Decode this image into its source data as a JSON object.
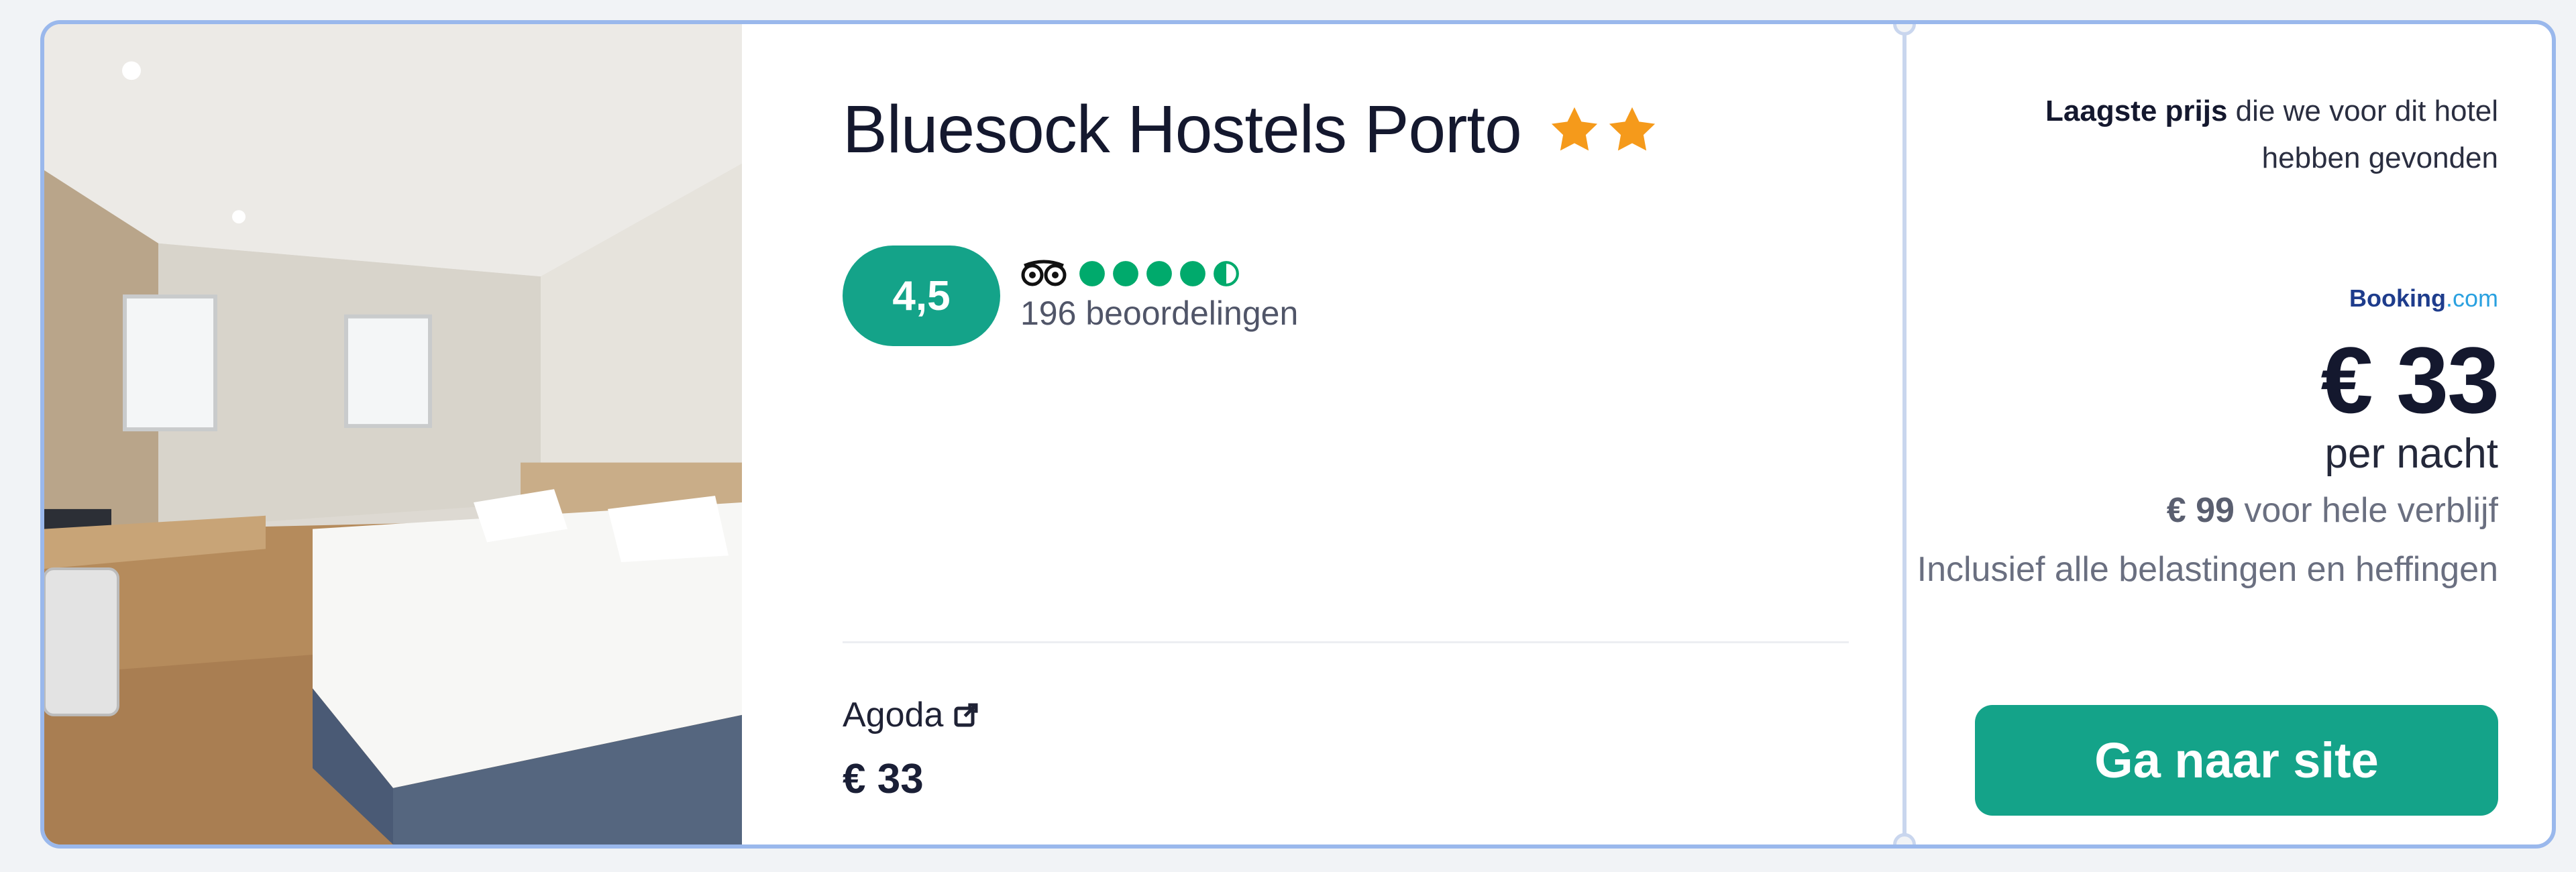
{
  "hotel": {
    "name": "Bluesock Hostels Porto",
    "stars": 2,
    "star_color": "#f59a1b"
  },
  "rating": {
    "score": "4,5",
    "score_color": "#14a389",
    "tripadvisor_bubbles": 4.5,
    "reviews": "196 beoordelingen"
  },
  "provider": {
    "name": "Agoda",
    "price": "€ 33"
  },
  "pricebox": {
    "lowest_bold": "Laagste prijs",
    "lowest_rest": " die we voor dit hotel hebben gevonden",
    "logo_main": "Booking",
    "logo_domain": ".com",
    "price": "€ 33",
    "per_night": "per nacht",
    "total_amount": "€ 99",
    "total_rest": " voor hele verblijf",
    "taxes": "Inclusief alle belastingen en heffingen",
    "cta_label": "Ga naar site"
  },
  "icons": {
    "star": "star-icon",
    "tripadvisor": "tripadvisor-owl-icon",
    "external": "external-link-icon"
  }
}
